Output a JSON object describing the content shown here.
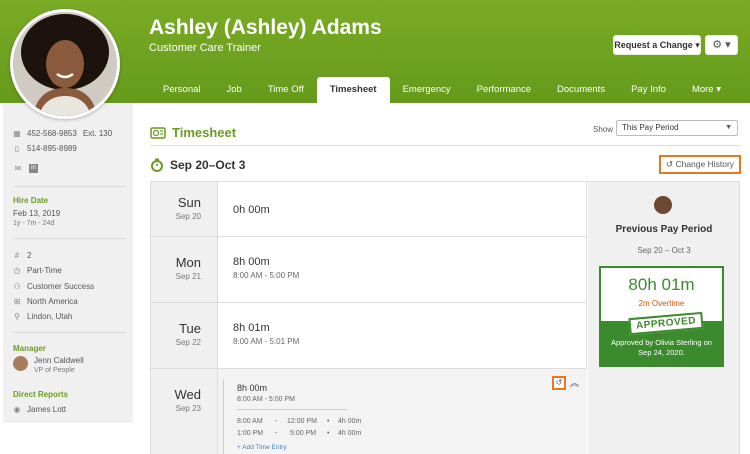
{
  "profile": {
    "name": "Ashley (Ashley) Adams",
    "job_title": "Customer Care Trainer",
    "request_change_label": "Request a Change",
    "gear_label": "⚙ ▾"
  },
  "tabs": [
    {
      "label": "Personal",
      "active": false
    },
    {
      "label": "Job",
      "active": false
    },
    {
      "label": "Time Off",
      "active": false
    },
    {
      "label": "Timesheet",
      "active": true
    },
    {
      "label": "Emergency",
      "active": false
    },
    {
      "label": "Performance",
      "active": false
    },
    {
      "label": "Documents",
      "active": false
    },
    {
      "label": "Pay Info",
      "active": false
    },
    {
      "label": "More",
      "active": false
    }
  ],
  "sidebar": {
    "work_phone": "452-568-9853",
    "work_ext": "Ext. 130",
    "mobile_phone": "514-895-8989",
    "hire_date_label": "Hire Date",
    "hire_date": "Feb 13, 2019",
    "tenure": "1y - 7m - 24d",
    "employee_number": "2",
    "employment_type": "Part-Time",
    "department": "Customer Success",
    "division": "North America",
    "location": "Lindon, Utah",
    "manager_label": "Manager",
    "manager_name": "Jenn Caldwell",
    "manager_title": "VP of People",
    "direct_reports_label": "Direct Reports",
    "direct_report_name": "James Lott"
  },
  "timesheet": {
    "title": "Timesheet",
    "show_label": "Show",
    "show_value": "This Pay Period",
    "period_label": "Sep 20–Oct 3",
    "change_history_label": "Change History",
    "days": [
      {
        "name": "Sun",
        "date": "Sep 20",
        "total": "0h 00m",
        "range": ""
      },
      {
        "name": "Mon",
        "date": "Sep 21",
        "total": "8h 00m",
        "range": "8:00 AM - 5:00 PM"
      },
      {
        "name": "Tue",
        "date": "Sep 22",
        "total": "8h 01m",
        "range": "8:00 AM - 5:01 PM"
      },
      {
        "name": "Wed",
        "date": "Sep 23",
        "total": "8h 00m",
        "range": "8:00 AM - 5:00 PM"
      }
    ],
    "wed_entries": [
      {
        "start": "8:00 AM",
        "end": "12:00 PM",
        "hours": "4h 00m"
      },
      {
        "start": "1:00 PM",
        "end": "5:00 PM",
        "hours": "4h 00m"
      }
    ],
    "add_entry_label": "+ Add Time Entry"
  },
  "summary": {
    "title": "Previous Pay Period",
    "range": "Sep 20 – Oct 3",
    "hours": "80h 01m",
    "overtime": "2m Overtime",
    "status": "APPROVED",
    "approved_by": "Approved by Olivia Sterling on Sep 24, 2020."
  },
  "colors": {
    "brand_green": "#6a9c1f",
    "approved_green": "#3c8a2e",
    "highlight_orange": "#e87722"
  }
}
